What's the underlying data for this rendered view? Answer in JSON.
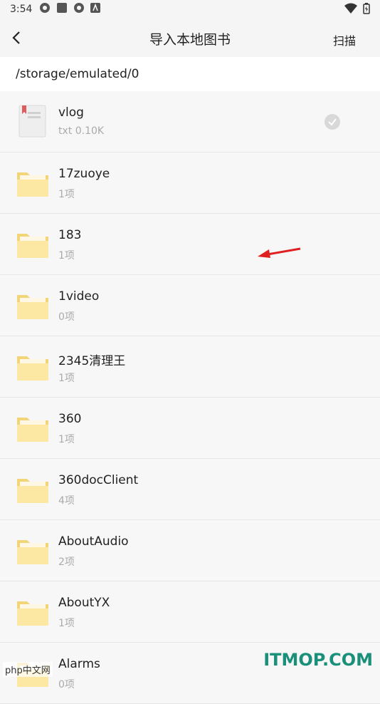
{
  "status": {
    "time": "3:54"
  },
  "header": {
    "title": "导入本地图书",
    "scan_label": "扫描"
  },
  "path": "/storage/emulated/0",
  "files": [
    {
      "name": "vlog",
      "meta": "txt   0.10K",
      "type": "file",
      "selected": true
    },
    {
      "name": "17zuoye",
      "meta": "1项",
      "type": "folder"
    },
    {
      "name": "183",
      "meta": "1项",
      "type": "folder"
    },
    {
      "name": "1video",
      "meta": "0项",
      "type": "folder"
    },
    {
      "name": "2345清理王",
      "meta": "1项",
      "type": "folder"
    },
    {
      "name": "360",
      "meta": "1项",
      "type": "folder"
    },
    {
      "name": "360docClient",
      "meta": "4项",
      "type": "folder"
    },
    {
      "name": "AboutAudio",
      "meta": "2项",
      "type": "folder"
    },
    {
      "name": "AboutYX",
      "meta": "1项",
      "type": "folder"
    },
    {
      "name": "Alarms",
      "meta": "0项",
      "type": "folder"
    }
  ],
  "watermarks": {
    "itmop": "ITMOP.COM",
    "php": "php中文网"
  }
}
